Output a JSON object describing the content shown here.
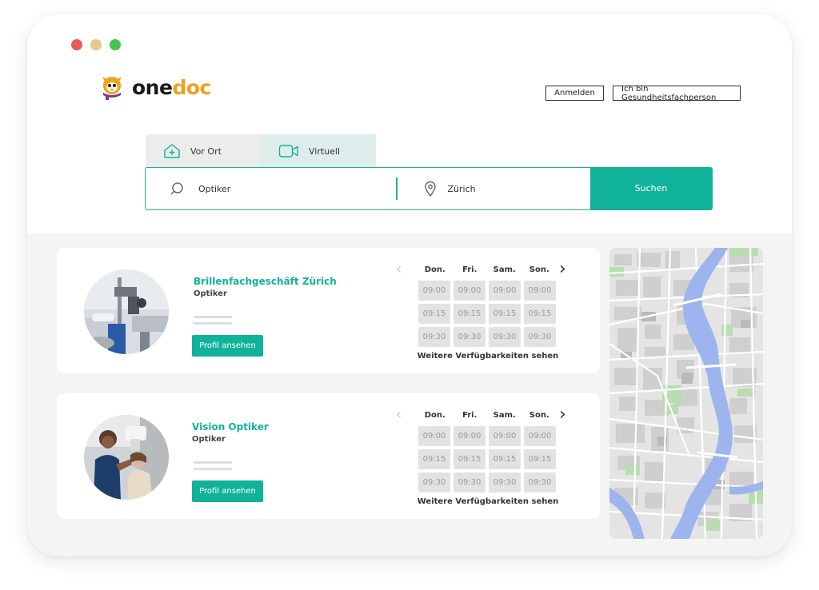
{
  "colors": {
    "accent": "#10b39a",
    "logo_orange": "#f0a01c",
    "dot_red": "#e85a5a",
    "dot_yellow": "#e6c88a",
    "dot_green": "#45c44c"
  },
  "header": {
    "logo": {
      "part1": "one",
      "part2": "doc"
    },
    "login_label": "Anmelden",
    "pro_label": "Ich bin Gesundheitsfachperson"
  },
  "tabs": [
    {
      "label": "Vor Ort",
      "icon": "house-plus-icon"
    },
    {
      "label": "Virtuell",
      "icon": "video-camera-icon"
    }
  ],
  "search": {
    "query_value": "Optiker",
    "location_value": "Zürich",
    "button_label": "Suchen"
  },
  "results": [
    {
      "name": "Brillenfachgeschäft Zürich",
      "category": "Optiker",
      "profile_label": "Profil ansehen",
      "days": [
        "Don.",
        "Fri.",
        "Sam.",
        "Son."
      ],
      "slots": [
        "09:00",
        "09:00",
        "09:00",
        "09:00",
        "09:15",
        "09:15",
        "09:15",
        "09:15",
        "09:30",
        "09:30",
        "09:30",
        "09:30"
      ],
      "more_label": "Weitere Verfügbarkeiten sehen"
    },
    {
      "name": "Vision Optiker",
      "category": "Optiker",
      "profile_label": "Profil ansehen",
      "days": [
        "Don.",
        "Fri.",
        "Sam.",
        "Son."
      ],
      "slots": [
        "09:00",
        "09:00",
        "09:00",
        "09:00",
        "09:15",
        "09:15",
        "09:15",
        "09:15",
        "09:30",
        "09:30",
        "09:30",
        "09:30"
      ],
      "more_label": "Weitere Verfügbarkeiten sehen"
    }
  ]
}
